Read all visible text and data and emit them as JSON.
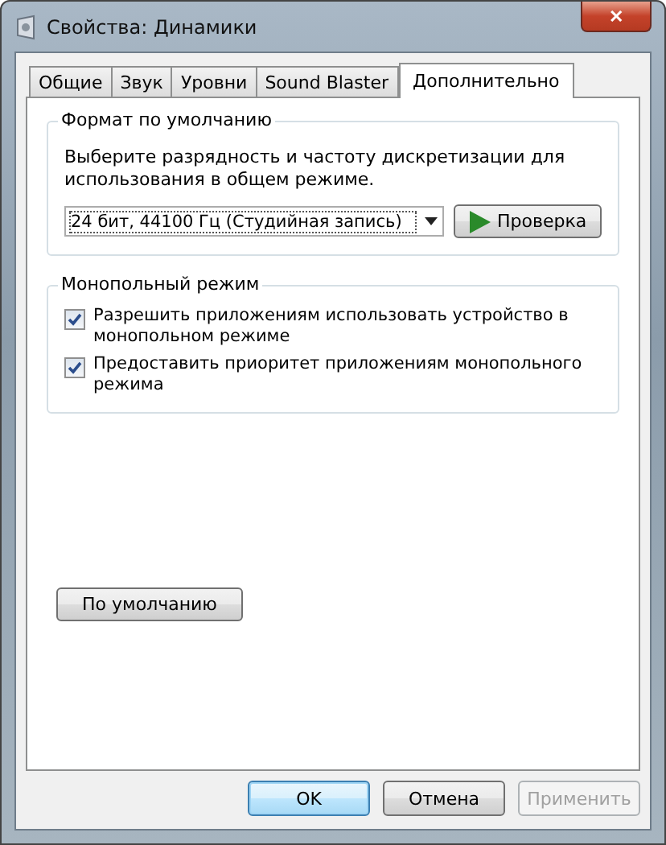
{
  "window": {
    "title": "Свойства: Динамики",
    "close": "✕"
  },
  "tabs": [
    {
      "label": "Общие",
      "selected": false
    },
    {
      "label": "Звук",
      "selected": false
    },
    {
      "label": "Уровни",
      "selected": false
    },
    {
      "label": "Sound Blaster",
      "selected": false
    },
    {
      "label": "Дополнительно",
      "selected": true
    }
  ],
  "default_format": {
    "title": "Формат по умолчанию",
    "description": "Выберите разрядность и частоту дискретизации для использования в общем режиме.",
    "format": "24 бит, 44100 Гц (Студийная запись)",
    "test_button": "Проверка"
  },
  "exclusive_mode": {
    "title": "Монопольный режим",
    "options": [
      {
        "label": "Разрешить приложениям использовать устройство в монопольном режиме",
        "checked": true
      },
      {
        "label": "Предоставить приоритет приложениям монопольного режима",
        "checked": true
      }
    ]
  },
  "restore_defaults": "По умолчанию",
  "buttons": [
    {
      "label": "OK",
      "kind": "default",
      "disabled": false
    },
    {
      "label": "Отмена",
      "kind": "normal",
      "disabled": false
    },
    {
      "label": "Применить",
      "kind": "normal",
      "disabled": true
    }
  ]
}
